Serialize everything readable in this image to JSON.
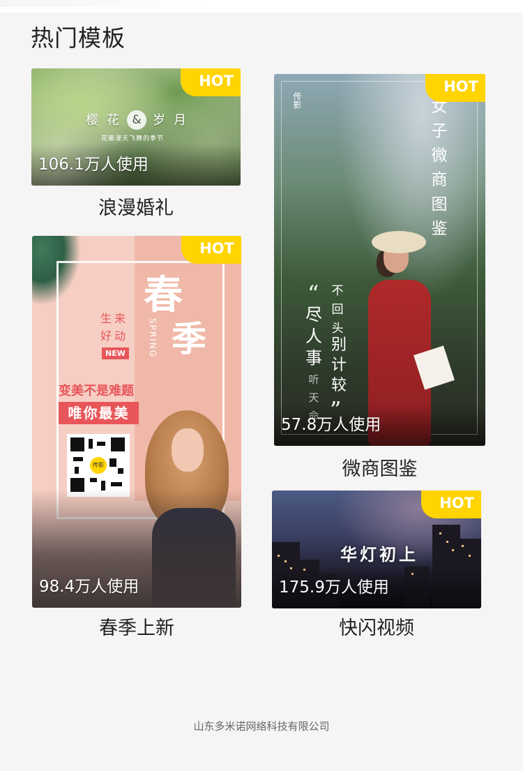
{
  "section_title": "热门模板",
  "hot_badge": "HOT",
  "templates": [
    {
      "name": "浪漫婚礼",
      "usage": "106.1万人使用",
      "card_text": {
        "left": "樱花",
        "amp": "&",
        "right": "岁月",
        "subtitle": "花瓣漫天飞舞的季节"
      }
    },
    {
      "name": "春季上新",
      "usage": "98.4万人使用",
      "card_text": {
        "big1": "春",
        "big2": "季",
        "spring": "SPRING",
        "line1": "生来",
        "line2": "好动",
        "new_badge": "NEW",
        "slogan1": "变美不是难题",
        "slogan2": "唯你最美",
        "qr_logo": "传影"
      }
    },
    {
      "name": "微商图鉴",
      "usage": "57.8万人使用",
      "card_text": {
        "logo": "传影",
        "vertical_title": "女子微商图鉴",
        "open_quote": "“",
        "col1": "尽人事",
        "col1b": "听天命",
        "col2": "不回头",
        "col3": "别计较",
        "close_quote": "”"
      }
    },
    {
      "name": "快闪视频",
      "usage": "175.9万人使用",
      "card_text": {
        "title": "华灯初上"
      }
    }
  ],
  "footer": "山东多米诺网络科技有限公司",
  "colors": {
    "hot_badge": "#ffd400",
    "accent_red": "#e8565a",
    "page_bg": "#f5f5f5"
  }
}
